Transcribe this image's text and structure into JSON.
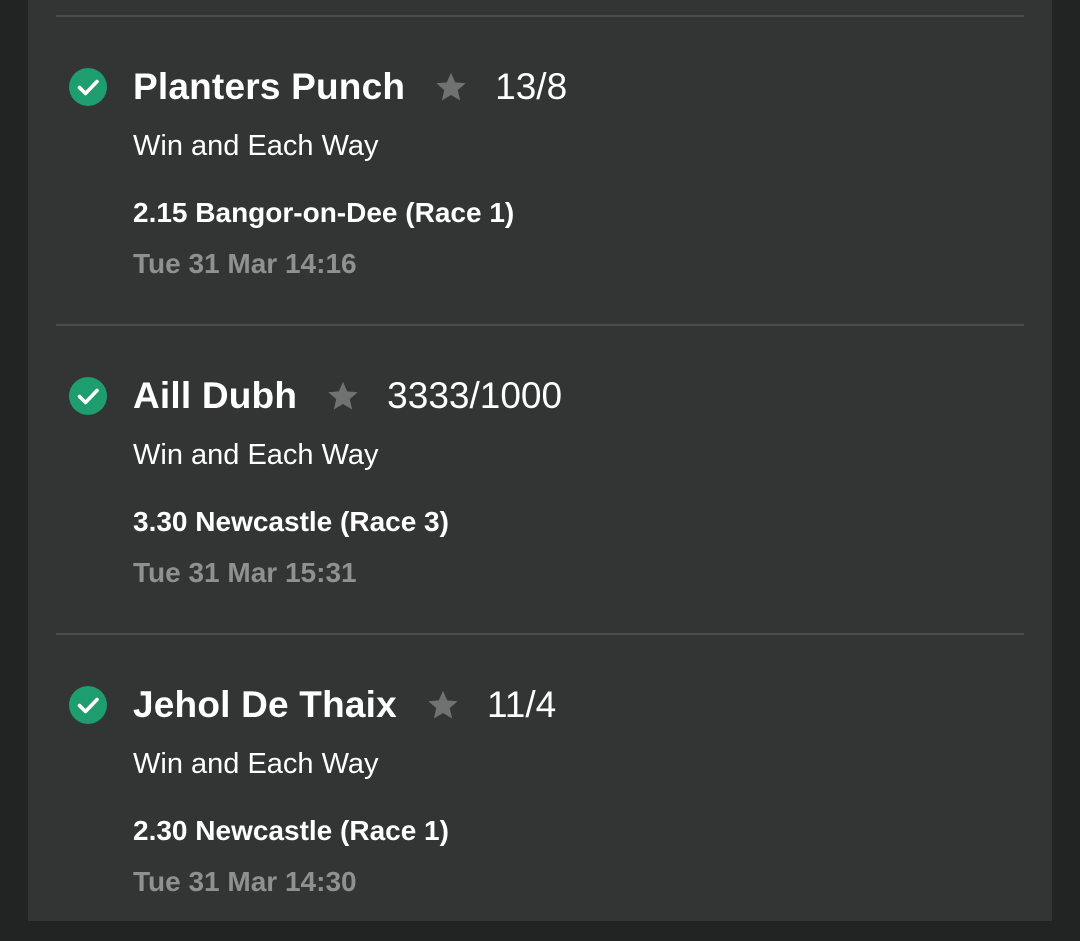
{
  "selections": [
    {
      "runner": "Planters Punch",
      "odds": "13/8",
      "market": "Win and Each Way",
      "event": "2.15 Bangor-on-Dee (Race 1)",
      "time": "Tue 31 Mar 14:16"
    },
    {
      "runner": "Aill Dubh",
      "odds": "3333/1000",
      "market": "Win and Each Way",
      "event": "3.30 Newcastle (Race 3)",
      "time": "Tue 31 Mar 15:31"
    },
    {
      "runner": "Jehol De Thaix",
      "odds": "11/4",
      "market": "Win and Each Way",
      "event": "2.30 Newcastle (Race 1)",
      "time": "Tue 31 Mar 14:30"
    }
  ],
  "colors": {
    "check": "#1e9e6e",
    "star": "#6f7270",
    "background": "#323533"
  },
  "icons": {
    "status": "check-circle-icon",
    "favourite": "star-icon"
  }
}
